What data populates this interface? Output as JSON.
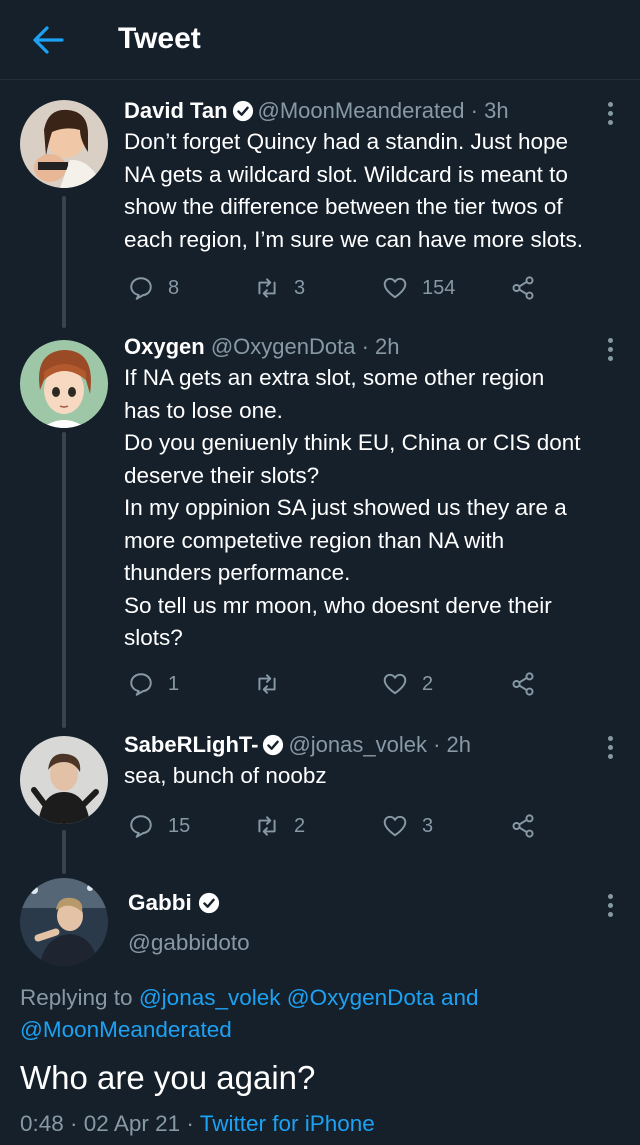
{
  "header": {
    "title": "Tweet"
  },
  "thread": [
    {
      "name": "David Tan",
      "verified": true,
      "handle": "@MoonMeanderated",
      "time": "3h",
      "text": "Don’t forget Quincy had a standin. Just hope\nNA gets a wildcard slot. Wildcard is meant to\nshow the difference between the tier twos of\neach region, I’m sure we can have more slots.",
      "replies": "8",
      "retweets": "3",
      "likes": "154"
    },
    {
      "name": "Oxygen",
      "verified": false,
      "handle": "@OxygenDota",
      "time": "2h",
      "text": "If NA gets an extra slot, some other region\nhas to lose one.\nDo you geniuenly think EU, China or CIS dont\ndeserve their slots?\nIn my oppinion SA just showed us they are a\nmore competetive region than NA with\nthunders performance.\nSo tell us mr moon, who doesnt derve their\nslots?",
      "replies": "1",
      "retweets": "",
      "likes": "2"
    },
    {
      "name": "SabeRLighT-",
      "verified": true,
      "handle": "@jonas_volek",
      "time": "2h",
      "text": "sea, bunch of noobz",
      "replies": "15",
      "retweets": "2",
      "likes": "3"
    }
  ],
  "main_tweet": {
    "name": "Gabbi",
    "verified": true,
    "handle": "@gabbidoto",
    "replying_label": "Replying to",
    "reply_handle_1": "@jonas_volek",
    "reply_handle_2": "@OxygenDota",
    "reply_and": "and",
    "reply_handle_3": "@MoonMeanderated",
    "text": "Who are you again?",
    "time": "0:48",
    "date": "02 Apr 21",
    "source": "Twitter for iPhone"
  },
  "colors": {
    "background": "#15202b",
    "accent": "#1da1f2",
    "secondary_text": "#8899a6",
    "thread_line": "#38444d"
  },
  "icons": {
    "back": "arrow-left-icon",
    "verified": "verified-badge-icon",
    "reply": "reply-bubble-icon",
    "retweet": "retweet-icon",
    "like": "heart-icon",
    "share": "share-icon",
    "more": "more-vertical-icon"
  }
}
